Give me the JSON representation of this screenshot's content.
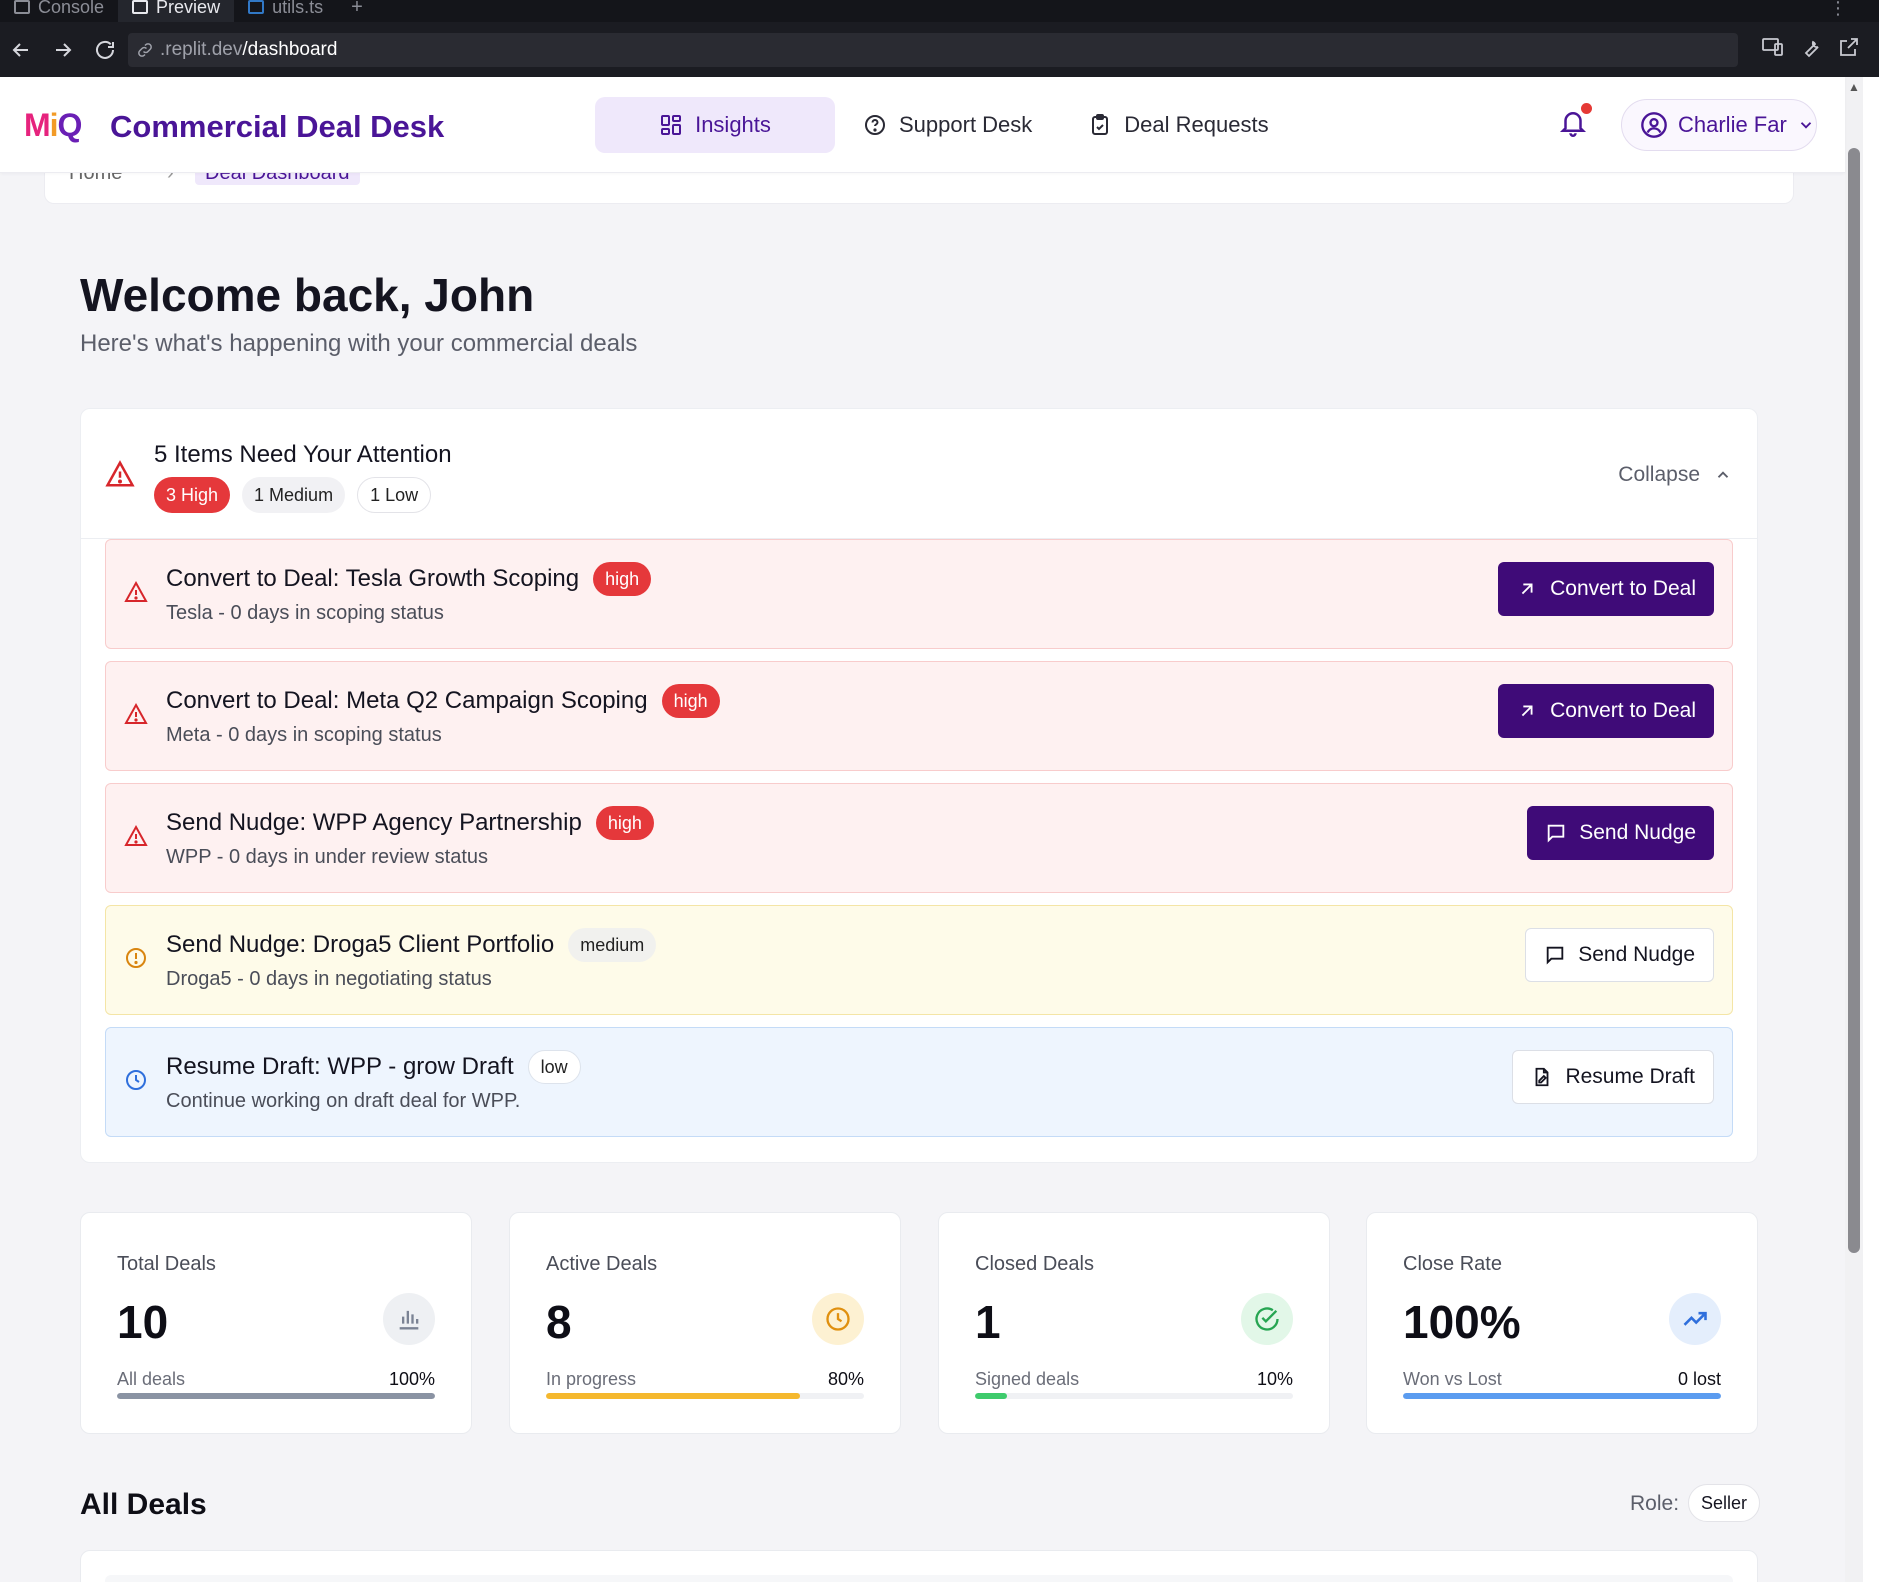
{
  "browser": {
    "tabs": [
      "Console",
      "Preview",
      "utils.ts"
    ],
    "active_tab": "Preview",
    "url_domain": ".replit.dev",
    "url_path": "/dashboard"
  },
  "header": {
    "logo": {
      "m": "M",
      "i": "i",
      "q": "Q"
    },
    "title": "Commercial Deal Desk",
    "nav": [
      {
        "label": "Insights",
        "icon": "grid-icon",
        "active": true
      },
      {
        "label": "Support Desk",
        "icon": "help-circle-icon",
        "active": false
      },
      {
        "label": "Deal Requests",
        "icon": "clipboard-icon",
        "active": false
      }
    ],
    "notification_dot": true,
    "user_name": "Charlie Far"
  },
  "breadcrumb": {
    "home": "Home",
    "current": "Deal Dashboard"
  },
  "welcome": {
    "title": "Welcome back, John",
    "subtitle": "Here's what's happening with your commercial deals"
  },
  "attention": {
    "title": "5 Items Need Your Attention",
    "pills": {
      "high": "3 High",
      "medium": "1 Medium",
      "low": "1 Low"
    },
    "collapse_label": "Collapse",
    "items": [
      {
        "title": "Convert to Deal: Tesla Growth Scoping",
        "badge": "high",
        "desc": "Tesla - 0 days in scoping status",
        "action": "Convert to Deal"
      },
      {
        "title": "Convert to Deal: Meta Q2 Campaign Scoping",
        "badge": "high",
        "desc": "Meta - 0 days in scoping status",
        "action": "Convert to Deal"
      },
      {
        "title": "Send Nudge: WPP Agency Partnership",
        "badge": "high",
        "desc": "WPP - 0 days in under review status",
        "action": "Send Nudge"
      },
      {
        "title": "Send Nudge: Droga5 Client Portfolio",
        "badge": "medium",
        "desc": "Droga5 - 0 days in negotiating status",
        "action": "Send Nudge"
      },
      {
        "title": "Resume Draft: WPP - grow Draft",
        "badge": "low",
        "desc": "Continue working on draft deal for WPP.",
        "action": "Resume Draft"
      }
    ]
  },
  "stats": [
    {
      "label": "Total Deals",
      "value": "10",
      "sub": "All deals",
      "pct": "100%",
      "progress": 1.0,
      "icon": "bar-chart-icon",
      "color": "#8a93a3",
      "icon_bg": "#eef0f3",
      "icon_color": "#7b8394"
    },
    {
      "label": "Active Deals",
      "value": "8",
      "sub": "In progress",
      "pct": "80%",
      "progress": 0.8,
      "icon": "clock-icon",
      "color": "#f5b82e",
      "icon_bg": "#fdf1d2",
      "icon_color": "#e0900f"
    },
    {
      "label": "Closed Deals",
      "value": "1",
      "sub": "Signed deals",
      "pct": "10%",
      "progress": 0.1,
      "icon": "check-circle-icon",
      "color": "#3ecb6c",
      "icon_bg": "#e2f7e8",
      "icon_color": "#27a552"
    },
    {
      "label": "Close Rate",
      "value": "100%",
      "sub": "Won vs Lost",
      "pct": "0 lost",
      "progress": 1.0,
      "icon": "trending-up-icon",
      "color": "#5b9cf0",
      "icon_bg": "#e4eefc",
      "icon_color": "#2f6fdc"
    }
  ],
  "all_deals": {
    "title": "All Deals",
    "role_label": "Role:",
    "role_value": "Seller"
  }
}
